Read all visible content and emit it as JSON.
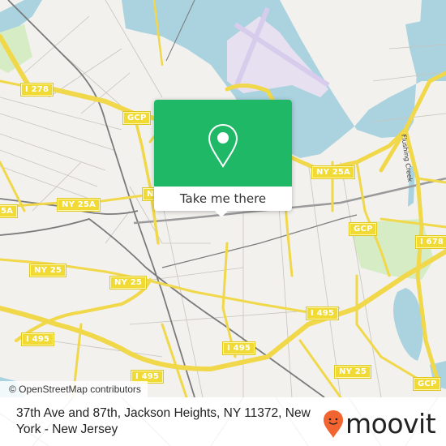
{
  "map": {
    "shields": [
      {
        "label": "I 278",
        "name": "shield-i278"
      },
      {
        "label": "GCP",
        "name": "shield-gcp-west"
      },
      {
        "label": "NY 25A",
        "name": "shield-ny25a-west"
      },
      {
        "label": "5A",
        "name": "shield-ny25a-edge"
      },
      {
        "label": "N",
        "name": "shield-partial-center"
      },
      {
        "label": "NY 25A",
        "name": "shield-ny25a-east"
      },
      {
        "label": "GCP",
        "name": "shield-gcp-east"
      },
      {
        "label": "I 678",
        "name": "shield-i678"
      },
      {
        "label": "NY 25",
        "name": "shield-ny25-west"
      },
      {
        "label": "NY 25",
        "name": "shield-ny25-center"
      },
      {
        "label": "I 495",
        "name": "shield-i495-west"
      },
      {
        "label": "I 495",
        "name": "shield-i495-center"
      },
      {
        "label": "I 495",
        "name": "shield-i495-east"
      },
      {
        "label": "I 495",
        "name": "shield-i495-bottom"
      },
      {
        "label": "NY 25",
        "name": "shield-ny25-east"
      },
      {
        "label": "GCP",
        "name": "shield-gcp-southeast"
      }
    ],
    "street_label": "Flushing Creek",
    "colors": {
      "land": "#f2f1ee",
      "water": "#aad3df",
      "park": "#d6ecc4",
      "road_major": "#f7e26b",
      "rail": "#7a7a7a",
      "airport": "#e6e0f0"
    }
  },
  "popup": {
    "icon": "map-pin-icon",
    "cta_label": "Take me there",
    "accent_color": "#1fb866"
  },
  "attribution": "© OpenStreetMap contributors",
  "footer": {
    "address": "37th Ave and 87th, Jackson Heights, NY 11372, New York - New Jersey",
    "brand": "moovit",
    "brand_icon": "moovit-pin-smile-icon",
    "brand_color": "#f26430"
  }
}
